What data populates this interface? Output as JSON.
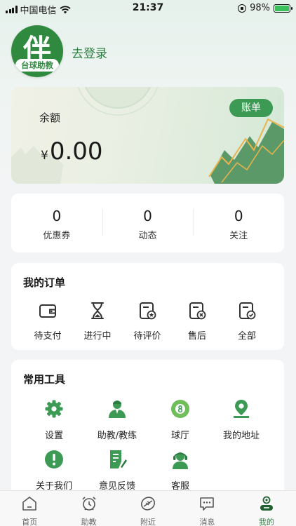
{
  "status_bar": {
    "carrier": "中国电信",
    "time": "21:37",
    "battery": "98%"
  },
  "colors": {
    "brand": "#2e7d43",
    "accent": "#3c9a54",
    "card": "#ffffff",
    "background": "#f3f4f5"
  },
  "profile": {
    "avatar_glyph": "伴",
    "avatar_brand": "台球助教",
    "login_label": "去登录"
  },
  "balance": {
    "label": "余额",
    "currency": "¥",
    "amount": "0.00",
    "bill_button": "账单"
  },
  "stats": [
    {
      "value": "0",
      "label": "优惠券"
    },
    {
      "value": "0",
      "label": "动态"
    },
    {
      "value": "0",
      "label": "关注"
    }
  ],
  "orders": {
    "title": "我的订单",
    "items": [
      {
        "label": "待支付",
        "icon": "wallet-icon"
      },
      {
        "label": "进行中",
        "icon": "hourglass-icon"
      },
      {
        "label": "待评价",
        "icon": "review-doc-icon"
      },
      {
        "label": "售后",
        "icon": "after-sales-doc-icon"
      },
      {
        "label": "全部",
        "icon": "all-orders-doc-icon"
      }
    ]
  },
  "tools": {
    "title": "常用工具",
    "items": [
      {
        "label": "设置",
        "icon": "gear-icon"
      },
      {
        "label": "助教/教练",
        "icon": "coach-icon"
      },
      {
        "label": "球厅",
        "icon": "billiard-ball-icon"
      },
      {
        "label": "我的地址",
        "icon": "location-pin-icon"
      },
      {
        "label": "关于我们",
        "icon": "info-icon"
      },
      {
        "label": "意见反馈",
        "icon": "feedback-icon"
      },
      {
        "label": "客服",
        "icon": "customer-service-icon"
      }
    ]
  },
  "tab_bar": {
    "active": "我的",
    "items": [
      {
        "label": "首页",
        "icon": "home-icon"
      },
      {
        "label": "助教",
        "icon": "alarm-clock-icon"
      },
      {
        "label": "附近",
        "icon": "nearby-ball-icon"
      },
      {
        "label": "消息",
        "icon": "message-icon"
      },
      {
        "label": "我的",
        "icon": "profile-icon"
      }
    ]
  }
}
